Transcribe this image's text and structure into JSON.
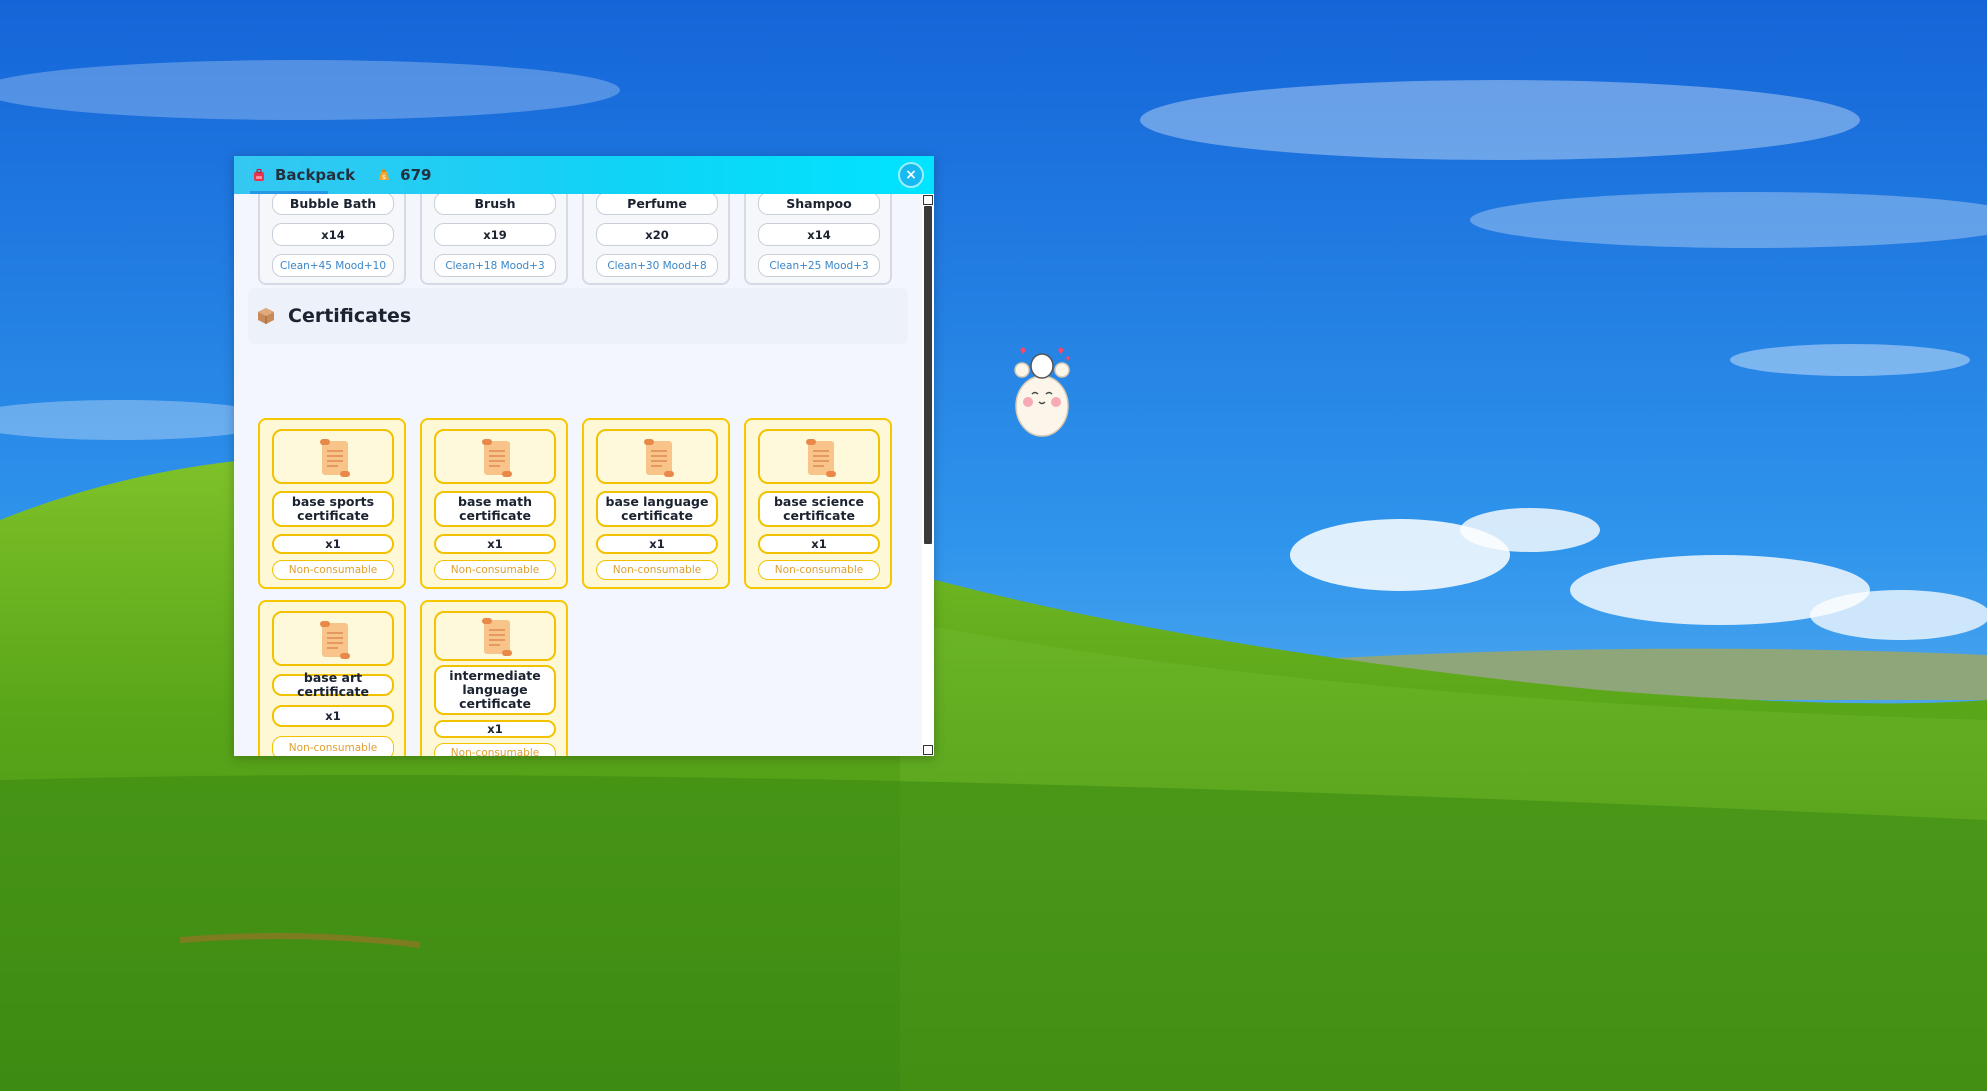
{
  "window": {
    "title": "Backpack",
    "coins": "679",
    "close_label": "×"
  },
  "care_items": [
    {
      "name": "Bubble Bath",
      "quantity": "x14",
      "effect": "Clean+45 Mood+10"
    },
    {
      "name": "Brush",
      "quantity": "x19",
      "effect": "Clean+18 Mood+3"
    },
    {
      "name": "Perfume",
      "quantity": "x20",
      "effect": "Clean+30 Mood+8"
    },
    {
      "name": "Shampoo",
      "quantity": "x14",
      "effect": "Clean+25 Mood+3"
    }
  ],
  "certificates": {
    "heading": "Certificates",
    "items": [
      {
        "name": "base sports certificate",
        "quantity": "x1",
        "status": "Non-consumable"
      },
      {
        "name": "base math certificate",
        "quantity": "x1",
        "status": "Non-consumable"
      },
      {
        "name": "base language certificate",
        "quantity": "x1",
        "status": "Non-consumable"
      },
      {
        "name": "base science certificate",
        "quantity": "x1",
        "status": "Non-consumable"
      },
      {
        "name": "base art certificate",
        "quantity": "x1",
        "status": "Non-consumable"
      },
      {
        "name": "intermediate language certificate",
        "quantity": "x1",
        "status": "Non-consumable"
      }
    ]
  },
  "icons": {
    "title": "backpack-icon",
    "coins": "coin-bag-icon",
    "section": "box-icon",
    "certificate": "scroll-icon",
    "close": "close-icon"
  },
  "colors": {
    "titlebar": "#10d3f5",
    "certificate_border": "#f7c700",
    "effect_text": "#3a86c8",
    "non_consumable_text": "#e0a030"
  }
}
